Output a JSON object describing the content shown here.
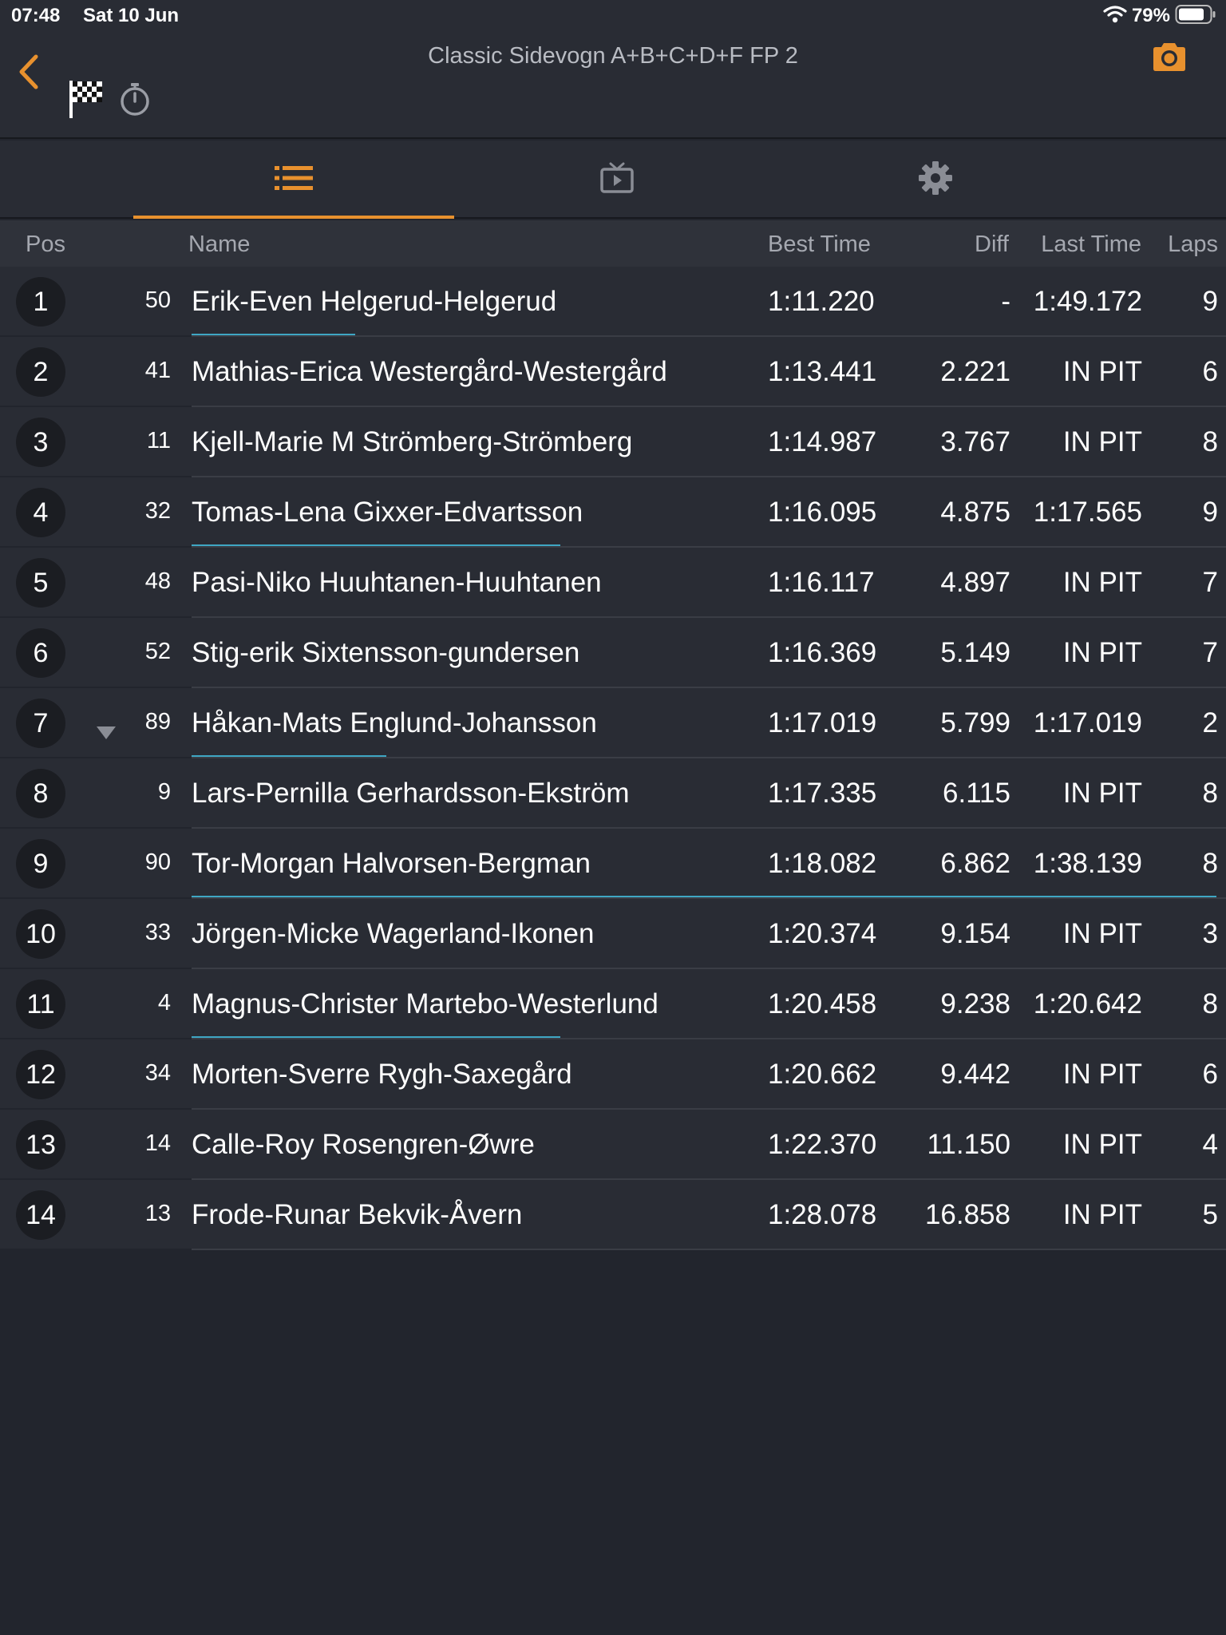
{
  "status_bar": {
    "time": "07:48",
    "date": "Sat 10 Jun",
    "battery": "79%"
  },
  "header": {
    "title": "Classic Sidevogn A+B+C+D+F FP 2"
  },
  "colors": {
    "accent": "#e8912e",
    "progress": "#3fa7c4",
    "background": "#22252d",
    "row": "#292c34"
  },
  "icons": {
    "back": "chevron-left-icon",
    "flag": "checkered-flag-icon",
    "stopwatch": "stopwatch-icon",
    "camera": "camera-icon",
    "list": "list-icon",
    "video": "tv-play-icon",
    "settings": "gear-icon"
  },
  "columns": {
    "pos": "Pos",
    "name": "Name",
    "best": "Best Time",
    "diff": "Diff",
    "last": "Last Time",
    "laps": "Laps"
  },
  "rows": [
    {
      "pos": "1",
      "num": "50",
      "name": "Erik-Even Helgerud-Helgerud",
      "best": "1:11.220",
      "diff": "-",
      "last": "1:49.172",
      "laps": "9",
      "progress": 0.16,
      "trend": ""
    },
    {
      "pos": "2",
      "num": "41",
      "name": "Mathias-Erica Westergård-Westergård",
      "best": "1:13.441",
      "diff": "2.221",
      "last": "IN PIT",
      "laps": "6",
      "progress": 0,
      "trend": ""
    },
    {
      "pos": "3",
      "num": "11",
      "name": "Kjell-Marie M Strömberg-Strömberg",
      "best": "1:14.987",
      "diff": "3.767",
      "last": "IN PIT",
      "laps": "8",
      "progress": 0,
      "trend": ""
    },
    {
      "pos": "4",
      "num": "32",
      "name": "Tomas-Lena Gixxer-Edvartsson",
      "best": "1:16.095",
      "diff": "4.875",
      "last": "1:17.565",
      "laps": "9",
      "progress": 0.36,
      "trend": ""
    },
    {
      "pos": "5",
      "num": "48",
      "name": "Pasi-Niko Huuhtanen-Huuhtanen",
      "best": "1:16.117",
      "diff": "4.897",
      "last": "IN PIT",
      "laps": "7",
      "progress": 0,
      "trend": ""
    },
    {
      "pos": "6",
      "num": "52",
      "name": "Stig-erik Sixtensson-gundersen",
      "best": "1:16.369",
      "diff": "5.149",
      "last": "IN PIT",
      "laps": "7",
      "progress": 0,
      "trend": ""
    },
    {
      "pos": "7",
      "num": "89",
      "name": "Håkan-Mats Englund-Johansson",
      "best": "1:17.019",
      "diff": "5.799",
      "last": "1:17.019",
      "laps": "2",
      "progress": 0.19,
      "trend": "down"
    },
    {
      "pos": "8",
      "num": "9",
      "name": "Lars-Pernilla Gerhardsson-Ekström",
      "best": "1:17.335",
      "diff": "6.115",
      "last": "IN PIT",
      "laps": "8",
      "progress": 0,
      "trend": ""
    },
    {
      "pos": "9",
      "num": "90",
      "name": "Tor-Morgan Halvorsen-Bergman",
      "best": "1:18.082",
      "diff": "6.862",
      "last": "1:38.139",
      "laps": "8",
      "progress": 1.0,
      "trend": ""
    },
    {
      "pos": "10",
      "num": "33",
      "name": "Jörgen-Micke Wagerland-Ikonen",
      "best": "1:20.374",
      "diff": "9.154",
      "last": "IN PIT",
      "laps": "3",
      "progress": 0,
      "trend": ""
    },
    {
      "pos": "11",
      "num": "4",
      "name": "Magnus-Christer Martebo-Westerlund",
      "best": "1:20.458",
      "diff": "9.238",
      "last": "1:20.642",
      "laps": "8",
      "progress": 0.36,
      "trend": ""
    },
    {
      "pos": "12",
      "num": "34",
      "name": "Morten-Sverre Rygh-Saxegård",
      "best": "1:20.662",
      "diff": "9.442",
      "last": "IN PIT",
      "laps": "6",
      "progress": 0,
      "trend": ""
    },
    {
      "pos": "13",
      "num": "14",
      "name": "Calle-Roy Rosengren-Øwre",
      "best": "1:22.370",
      "diff": "11.150",
      "last": "IN PIT",
      "laps": "4",
      "progress": 0,
      "trend": ""
    },
    {
      "pos": "14",
      "num": "13",
      "name": "Frode-Runar Bekvik-Åvern",
      "best": "1:28.078",
      "diff": "16.858",
      "last": "IN PIT",
      "laps": "5",
      "progress": 0,
      "trend": ""
    }
  ]
}
